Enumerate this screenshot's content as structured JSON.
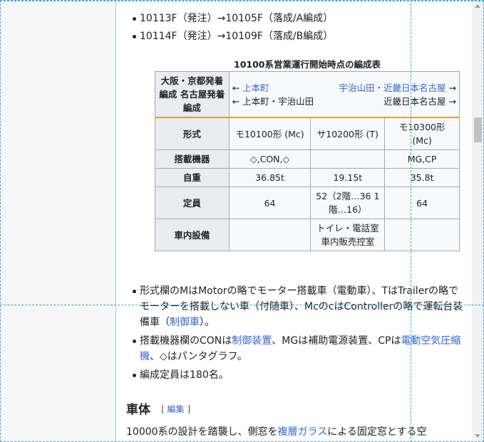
{
  "bullets_top": [
    "10113F（発注）→10105F（落成/A編成）",
    "10114F（発注）→10109F（落成/B編成）"
  ],
  "table": {
    "caption": "10100系営業運行開始時点の編成表",
    "header": {
      "label": "大阪・京都発着編成 名古屋発着編成",
      "row1_left_arrow": "← ",
      "row1_left_link": "上本町",
      "row1_right_link": "宇治山田・近畿日本名古屋",
      "row1_right_arrow": " →",
      "row2_left": "← 上本町・宇治山田",
      "row2_right": "近畿日本名古屋 →"
    },
    "rows": [
      {
        "label": "形式",
        "cells": [
          "モ10100形 (Mc)",
          "サ10200形 (T)",
          "モ10300形 (Mc)"
        ]
      },
      {
        "label": "搭載機器",
        "cells": [
          "◇,CON,◇",
          "",
          "MG,CP"
        ]
      },
      {
        "label": "自重",
        "cells": [
          "36.85t",
          "19.15t",
          "35.8t"
        ]
      },
      {
        "label": "定員",
        "cells": [
          "64",
          "52（2階…36 1階…16）",
          "64"
        ]
      },
      {
        "label": "車内設備",
        "cells": [
          "",
          "トイレ・電話室 車内販売控室",
          ""
        ]
      }
    ]
  },
  "notes": {
    "n1_pre": "形式欄のMはMotorの略でモーター搭載車（電動車）、TはTrailerの略でモーターを搭載しない車（付随車）、McのcはControllerの略で運転台装備車（",
    "n1_link": "制御車",
    "n1_post": "）。",
    "n2_pre": "搭載機器欄のCONは",
    "n2_link1": "制御装置",
    "n2_mid": "、MGは補助電源装置、CPは",
    "n2_link2": "電動空気圧縮機",
    "n2_post": "、◇はパンタグラフ。",
    "n3": "編成定員は180名。"
  },
  "section": {
    "heading": "車体",
    "edit_open": "[ ",
    "edit_label": "編集",
    "edit_close": " ]",
    "text_pre": "10000系の設計を踏襲し、側窓を",
    "text_link": "複層ガラス",
    "text_post": "による固定窓とする空"
  }
}
